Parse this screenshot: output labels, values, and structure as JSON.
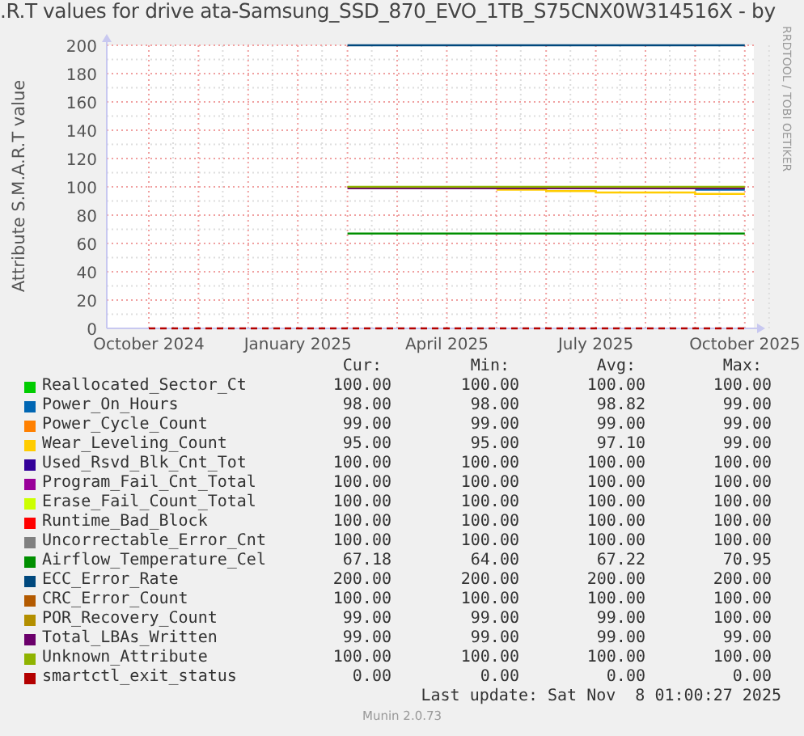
{
  "title": ".R.T values for drive ata-Samsung_SSD_870_EVO_1TB_S75CNX0W314516X - by",
  "watermark": "RRDTOOL / TOBI OETIKER",
  "chart": {
    "chart_data": {
      "type": "line",
      "ylabel": "Attribute S.M.A.R.T value",
      "categories": [
        "October 2024",
        null,
        null,
        "January 2025",
        null,
        null,
        "April 2025",
        null,
        null,
        "July 2025",
        null,
        null,
        "October 2025"
      ],
      "ylim": [
        0,
        200
      ],
      "grid": true,
      "yticks": [
        0,
        20,
        40,
        60,
        80,
        100,
        120,
        140,
        160,
        180,
        200
      ],
      "series": [
        {
          "name": "Reallocated_Sector_Ct",
          "color": "#00cc00",
          "values": [
            null,
            null,
            null,
            null,
            null,
            null,
            null,
            null,
            null,
            null,
            null,
            null,
            null
          ]
        },
        {
          "name": "Power_On_Hours",
          "color": "#0066b3",
          "values": [
            null,
            null,
            null,
            null,
            null,
            null,
            null,
            null,
            null,
            null,
            null,
            98,
            98
          ]
        },
        {
          "name": "Power_Cycle_Count",
          "color": "#ff8000",
          "values": [
            null,
            null,
            null,
            null,
            null,
            null,
            null,
            null,
            null,
            null,
            null,
            null,
            null
          ]
        },
        {
          "name": "Wear_Leveling_Count",
          "color": "#ffcc00",
          "values": [
            null,
            null,
            null,
            null,
            null,
            null,
            null,
            98,
            97,
            96,
            96,
            95,
            95
          ]
        },
        {
          "name": "Used_Rsvd_Blk_Cnt_Tot",
          "color": "#330099",
          "values": [
            null,
            null,
            null,
            null,
            null,
            null,
            null,
            null,
            null,
            null,
            null,
            null,
            null
          ]
        },
        {
          "name": "Program_Fail_Cnt_Total",
          "color": "#990099",
          "values": [
            null,
            null,
            null,
            null,
            null,
            null,
            null,
            null,
            null,
            null,
            null,
            null,
            null
          ]
        },
        {
          "name": "Erase_Fail_Count_Total",
          "color": "#ccff00",
          "values": [
            null,
            null,
            null,
            null,
            null,
            null,
            null,
            null,
            null,
            null,
            null,
            null,
            null
          ]
        },
        {
          "name": "Runtime_Bad_Block",
          "color": "#ff0000",
          "values": [
            null,
            null,
            null,
            null,
            null,
            null,
            null,
            null,
            null,
            null,
            null,
            null,
            null
          ]
        },
        {
          "name": "Uncorrectable_Error_Cnt",
          "color": "#808080",
          "values": [
            null,
            null,
            null,
            null,
            null,
            null,
            null,
            null,
            null,
            null,
            null,
            null,
            null
          ]
        },
        {
          "name": "Airflow_Temperature_Cel",
          "color": "#008f00",
          "values": [
            null,
            null,
            null,
            null,
            67,
            67,
            67,
            67,
            67,
            67,
            67,
            67,
            67
          ]
        },
        {
          "name": "ECC_Error_Rate",
          "color": "#00487d",
          "values": [
            null,
            null,
            null,
            null,
            200,
            200,
            200,
            200,
            200,
            200,
            200,
            200,
            200
          ]
        },
        {
          "name": "CRC_Error_Count",
          "color": "#b35a00",
          "values": [
            null,
            null,
            null,
            null,
            null,
            null,
            null,
            null,
            null,
            null,
            null,
            null,
            null
          ]
        },
        {
          "name": "POR_Recovery_Count",
          "color": "#b38f00",
          "values": [
            null,
            null,
            null,
            null,
            null,
            null,
            null,
            null,
            null,
            null,
            null,
            null,
            null
          ]
        },
        {
          "name": "Total_LBAs_Written",
          "color": "#6b006b",
          "values": [
            null,
            null,
            null,
            null,
            99,
            99,
            99,
            99,
            99,
            99,
            99,
            99,
            99
          ]
        },
        {
          "name": "Unknown_Attribute",
          "color": "#8fb300",
          "values": [
            null,
            null,
            null,
            null,
            100,
            100,
            100,
            100,
            100,
            100,
            100,
            100,
            100
          ]
        },
        {
          "name": "smartctl_exit_status",
          "color": "#b30000",
          "line_style": "dashed",
          "values": [
            0,
            0,
            0,
            0,
            0,
            0,
            0,
            0,
            0,
            0,
            0,
            0,
            0
          ]
        }
      ]
    }
  },
  "legend": {
    "columns": [
      "Cur:",
      "Min:",
      "Avg:",
      "Max:"
    ],
    "rows": [
      {
        "values": [
          "100.00",
          "100.00",
          "100.00",
          "100.00"
        ]
      },
      {
        "values": [
          "98.00",
          "98.00",
          "98.82",
          "99.00"
        ]
      },
      {
        "values": [
          "99.00",
          "99.00",
          "99.00",
          "99.00"
        ]
      },
      {
        "values": [
          "95.00",
          "95.00",
          "97.10",
          "99.00"
        ]
      },
      {
        "values": [
          "100.00",
          "100.00",
          "100.00",
          "100.00"
        ]
      },
      {
        "values": [
          "100.00",
          "100.00",
          "100.00",
          "100.00"
        ]
      },
      {
        "values": [
          "100.00",
          "100.00",
          "100.00",
          "100.00"
        ]
      },
      {
        "values": [
          "100.00",
          "100.00",
          "100.00",
          "100.00"
        ]
      },
      {
        "values": [
          "100.00",
          "100.00",
          "100.00",
          "100.00"
        ]
      },
      {
        "values": [
          "67.18",
          "64.00",
          "67.22",
          "70.95"
        ]
      },
      {
        "values": [
          "200.00",
          "200.00",
          "200.00",
          "200.00"
        ]
      },
      {
        "values": [
          "100.00",
          "100.00",
          "100.00",
          "100.00"
        ]
      },
      {
        "values": [
          "99.00",
          "99.00",
          "99.00",
          "100.00"
        ]
      },
      {
        "values": [
          "99.00",
          "99.00",
          "99.00",
          "99.00"
        ]
      },
      {
        "values": [
          "100.00",
          "100.00",
          "100.00",
          "100.00"
        ]
      },
      {
        "values": [
          "0.00",
          "0.00",
          "0.00",
          "0.00"
        ]
      }
    ]
  },
  "last_update": "Last update: Sat Nov  8 01:00:27 2025",
  "footer": "Munin 2.0.73"
}
